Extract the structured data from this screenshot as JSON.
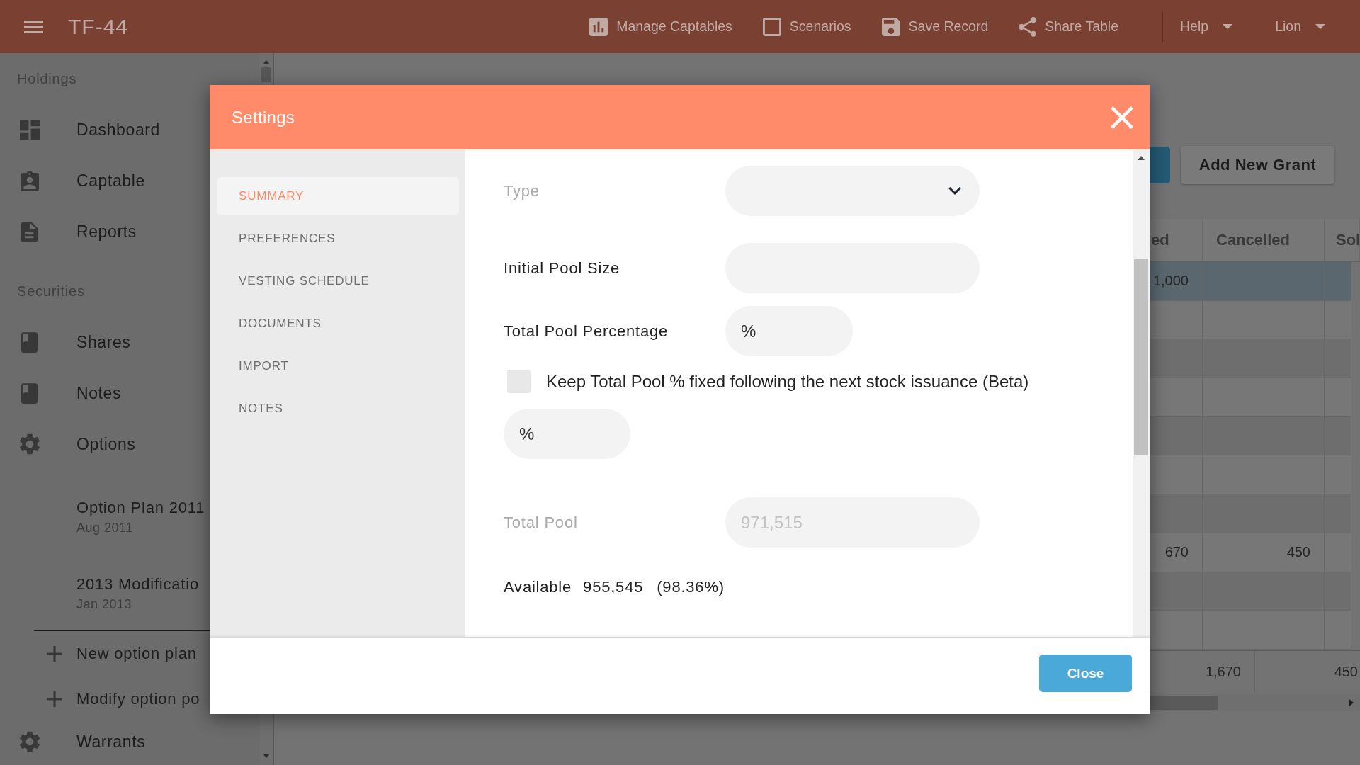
{
  "top_bar": {
    "title": "TF-44",
    "actions": [
      "Manage Captables",
      "Scenarios",
      "Save Record",
      "Share Table"
    ],
    "menus": [
      "Help",
      "Lion"
    ]
  },
  "sidebar": {
    "sections": [
      {
        "title": "Holdings",
        "items": [
          {
            "label": "Dashboard"
          },
          {
            "label": "Captable"
          },
          {
            "label": "Reports"
          }
        ]
      },
      {
        "title": "Securities",
        "items": [
          {
            "label": "Shares"
          },
          {
            "label": "Notes"
          },
          {
            "label": "Options",
            "children": [
              {
                "label": "Option Plan 2011",
                "date": "Aug 2011"
              },
              {
                "label": "2013 Modificatio",
                "date": "Jan 2013"
              }
            ],
            "actions": [
              "New option plan",
              "Modify option po"
            ]
          },
          {
            "label": "Warrants"
          }
        ]
      }
    ]
  },
  "main": {
    "buttons": [
      "Add New Grant"
    ],
    "table": {
      "columns": [
        "ed",
        "Cancelled",
        "Sol"
      ],
      "rows": [
        {
          "selected": true,
          "cells": [
            "1,000"
          ]
        },
        {
          "selected": false
        },
        {
          "selected": false
        },
        {
          "selected": false
        },
        {
          "selected": false
        },
        {
          "selected": false
        },
        {
          "selected": false
        },
        {
          "selected": false,
          "cells": [
            "670",
            "450"
          ]
        },
        {
          "selected": false
        },
        {
          "selected": false
        }
      ],
      "totals": [
        "1,670",
        "450"
      ]
    }
  },
  "dialog": {
    "title": "Settings",
    "nav": [
      {
        "label": "SUMMARY",
        "selected": true
      },
      {
        "label": "PREFERENCES",
        "selected": false
      },
      {
        "label": "VESTING SCHEDULE",
        "selected": false
      },
      {
        "label": "DOCUMENTS",
        "selected": false
      },
      {
        "label": "IMPORT",
        "selected": false
      },
      {
        "label": "NOTES",
        "selected": false
      }
    ],
    "form": [
      {
        "kind": "select",
        "label": "Type",
        "disabled": true
      },
      {
        "kind": "text",
        "label": "Initial Pool Size",
        "disabled": false
      },
      {
        "kind": "text",
        "label": "Total Pool Percentage",
        "value": "%",
        "disabled": false
      },
      {
        "kind": "checkbox",
        "label": "Keep Total Pool % fixed following the next stock issuance (Beta)",
        "checked": false
      },
      {
        "kind": "text",
        "value": "%",
        "disabled": false
      },
      {
        "kind": "text",
        "label": "Total Pool",
        "value": "971,515",
        "disabled": true
      },
      {
        "kind": "summary",
        "label": "Available",
        "value": "955,545",
        "note": "(98.36%)"
      }
    ],
    "buttons": [
      "Close"
    ]
  }
}
